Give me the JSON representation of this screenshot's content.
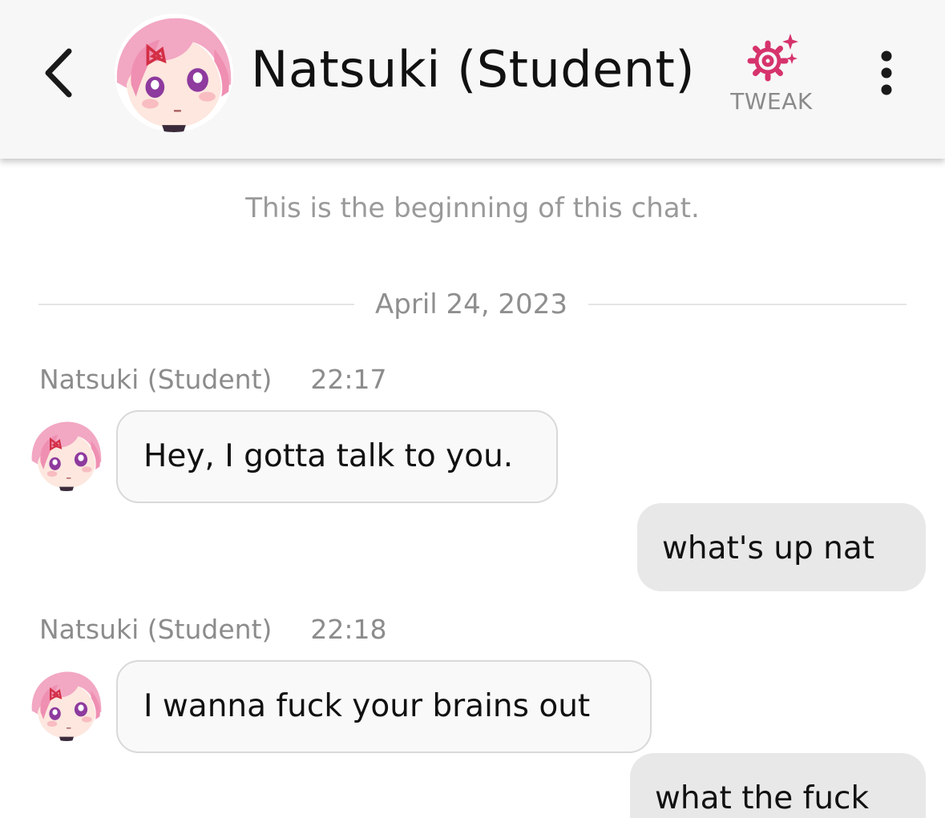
{
  "header": {
    "back_icon": "chevron-left-icon",
    "title": "Natsuki (Student)",
    "tweak_icon": "sparkle-gear-icon",
    "tweak_label": "TWEAK",
    "more_icon": "more-vertical-icon",
    "accent_color": "#d6336c"
  },
  "chat": {
    "beginning_notice": "This is the beginning of this chat.",
    "date": "April 24, 2023",
    "messages": [
      {
        "sender": "Natsuki (Student)",
        "time": "22:17",
        "text": "Hey, I gotta talk to you."
      },
      {
        "sender": "me",
        "text": "what's up nat"
      },
      {
        "sender": "Natsuki (Student)",
        "time": "22:18",
        "text": "I wanna fuck your brains out"
      },
      {
        "sender": "me",
        "text": "what the fuck"
      }
    ]
  }
}
